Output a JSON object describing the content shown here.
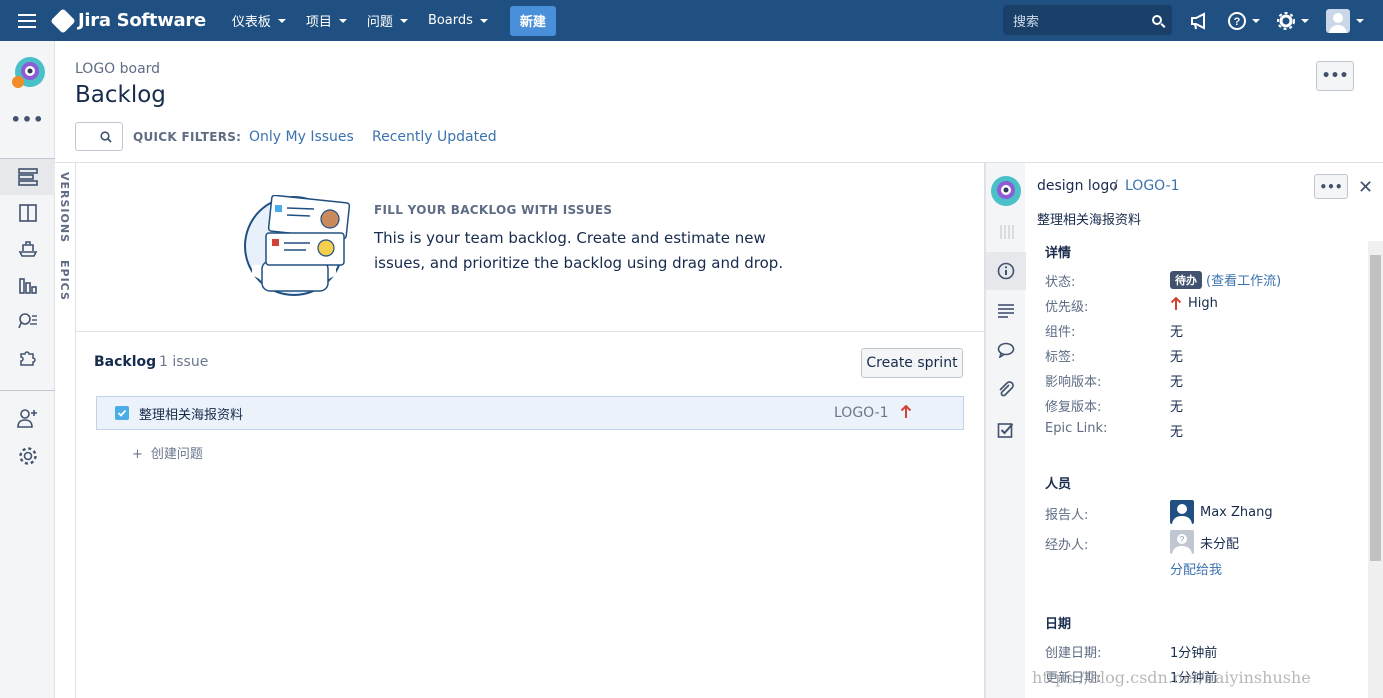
{
  "topnav": {
    "app_name": "Jira Software",
    "menus": [
      "仪表板",
      "项目",
      "问题",
      "Boards"
    ],
    "create_label": "新建",
    "search_placeholder": "搜索"
  },
  "header": {
    "board_name": "LOGO board",
    "title": "Backlog",
    "quick_filters_label": "QUICK FILTERS:",
    "quick_filters": [
      "Only My Issues",
      "Recently Updated"
    ]
  },
  "side_tabs": [
    "VERSIONS",
    "EPICS"
  ],
  "empty_state": {
    "heading": "FILL YOUR BACKLOG WITH ISSUES",
    "body": "This is your team backlog. Create and estimate new issues, and prioritize the backlog using drag and drop."
  },
  "backlog": {
    "title": "Backlog",
    "count": "1 issue",
    "create_sprint_label": "Create sprint",
    "issues": [
      {
        "summary": "整理相关海报资料",
        "key": "LOGO-1",
        "priority": "High"
      }
    ],
    "create_issue_label": "创建问题"
  },
  "detail": {
    "project": "design logo",
    "separator": "/",
    "key": "LOGO-1",
    "summary": "整理相关海报资料",
    "details_title": "详情",
    "fields": [
      {
        "label": "状态:",
        "value": "待办",
        "extra": "(查看工作流)"
      },
      {
        "label": "优先级:",
        "value": "High"
      },
      {
        "label": "组件:",
        "value": "无"
      },
      {
        "label": "标签:",
        "value": "无"
      },
      {
        "label": "影响版本:",
        "value": "无"
      },
      {
        "label": "修复版本:",
        "value": "无"
      },
      {
        "label": "Epic Link:",
        "value": "无"
      }
    ],
    "people_title": "人员",
    "reporter_label": "报告人:",
    "reporter": "Max Zhang",
    "assignee_label": "经办人:",
    "assignee": "未分配",
    "assign_to_me": "分配给我",
    "dates_title": "日期",
    "created_label": "创建日期:",
    "created": "1分钟前",
    "updated_label": "更新日期:",
    "updated": "1分钟前"
  },
  "watermark": "https://blog.csdn.net/haiyinshushe",
  "colors": {
    "topnav": "#205081",
    "link": "#3b73af",
    "priority_high": "#d04437",
    "status_todo": "#42526e"
  }
}
